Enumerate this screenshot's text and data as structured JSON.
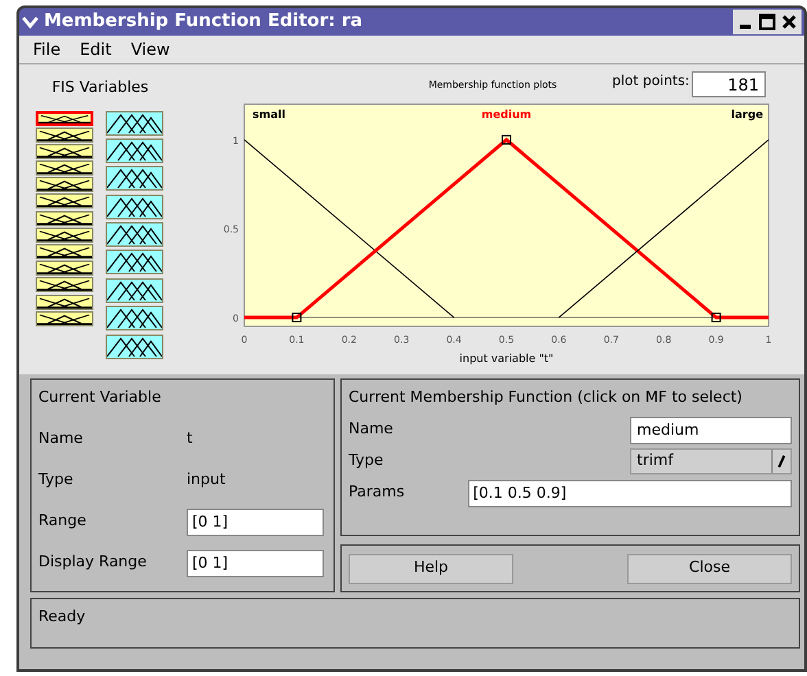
{
  "window": {
    "title": "Membership Function Editor: ra"
  },
  "menu": [
    "File",
    "Edit",
    "View"
  ],
  "fis_variables": {
    "title": "FIS Variables",
    "items": [
      {
        "kind": "input",
        "selected": true
      },
      {
        "kind": "input",
        "selected": false
      },
      {
        "kind": "input",
        "selected": false
      },
      {
        "kind": "input",
        "selected": false
      },
      {
        "kind": "input",
        "selected": false
      },
      {
        "kind": "input",
        "selected": false
      },
      {
        "kind": "input",
        "selected": false
      },
      {
        "kind": "input",
        "selected": false
      },
      {
        "kind": "input",
        "selected": false
      },
      {
        "kind": "input",
        "selected": false
      },
      {
        "kind": "input",
        "selected": false
      },
      {
        "kind": "input",
        "selected": false
      },
      {
        "kind": "input",
        "selected": false
      },
      {
        "kind": "output",
        "selected": false
      },
      {
        "kind": "output",
        "selected": false
      },
      {
        "kind": "output",
        "selected": false
      },
      {
        "kind": "output",
        "selected": false
      },
      {
        "kind": "output",
        "selected": false
      },
      {
        "kind": "output",
        "selected": false
      },
      {
        "kind": "output",
        "selected": false
      },
      {
        "kind": "output",
        "selected": false
      },
      {
        "kind": "output",
        "selected": false
      }
    ]
  },
  "plot": {
    "plot_points_label": "plot points:",
    "plot_points": "181",
    "mf_selected": [
      false,
      true,
      false
    ],
    "chart_data": {
      "type": "line",
      "title": "Membership function plots",
      "xlabel": "input variable \"t\"",
      "x": [
        0,
        0.1,
        0.4,
        0.5,
        0.6,
        0.9,
        1
      ],
      "series": [
        {
          "name": "small",
          "color": "#000000",
          "values": [
            1,
            0.75,
            0,
            null,
            null,
            null,
            null
          ]
        },
        {
          "name": "medium",
          "color": "#ff0000",
          "values": [
            0,
            0,
            0.75,
            1,
            0.75,
            0,
            0
          ]
        },
        {
          "name": "large",
          "color": "#000000",
          "values": [
            null,
            null,
            null,
            null,
            0,
            0.75,
            1
          ]
        }
      ],
      "xlim": [
        0,
        1
      ],
      "ylim": [
        -0.05,
        1.2
      ],
      "xticks": [
        0,
        0.1,
        0.2,
        0.3,
        0.4,
        0.5,
        0.6,
        0.7,
        0.8,
        0.9,
        1
      ],
      "yticks": [
        0,
        0.5,
        1
      ]
    }
  },
  "current_variable": {
    "title": "Current Variable",
    "fields": [
      {
        "kind": "text",
        "label": "Name",
        "value": "t"
      },
      {
        "kind": "text",
        "label": "Type",
        "value": "input"
      },
      {
        "kind": "field",
        "label": "Range",
        "value": "[0 1]"
      },
      {
        "kind": "field",
        "label": "Display Range",
        "value": "[0 1]"
      }
    ]
  },
  "current_mf": {
    "title": "Current Membership Function (click on MF to select)",
    "name_label": "Name",
    "name": "medium",
    "type_label": "Type",
    "type": "trimf",
    "params_label": "Params",
    "params": "[0.1 0.5 0.9]"
  },
  "buttons": [
    "Help",
    "Close"
  ],
  "status": "Ready"
}
